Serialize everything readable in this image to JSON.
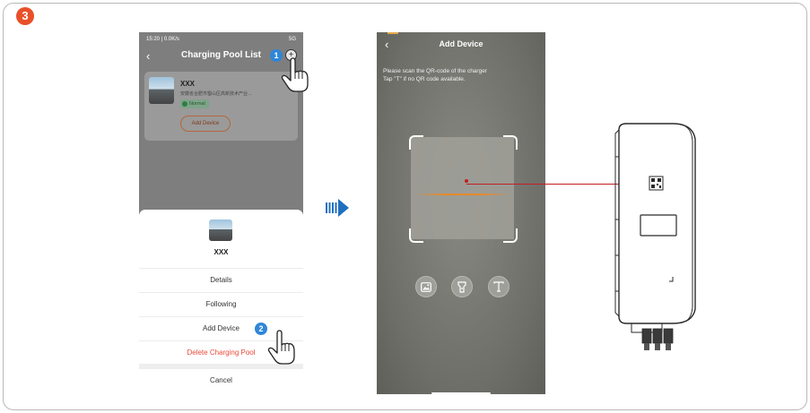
{
  "step_number": "3",
  "colors": {
    "accent": "#e8502a",
    "badge_blue": "#2f86d8",
    "danger": "#e84a3a",
    "scan_line": "#e68a2a",
    "pointer_line": "#c21f1f"
  },
  "phone1": {
    "status_bar": {
      "left": "15:20 | 0.0K/s",
      "right": "5G"
    },
    "title": "Charging Pool List",
    "back_icon": "chevron-left-icon",
    "add_icon": "plus-circle-icon",
    "card": {
      "name": "XXX",
      "address": "安徽省合肥市蜀山区高新技术产业...",
      "status": "Normal",
      "add_device_label": "Add Device"
    },
    "sheet": {
      "name": "XXX",
      "items": [
        {
          "label": "Details"
        },
        {
          "label": "Following"
        },
        {
          "label": "Add Device"
        },
        {
          "label": "Delete Charging Pool"
        }
      ],
      "cancel_label": "Cancel"
    },
    "callout_1": "1",
    "callout_2": "2"
  },
  "phone2": {
    "title": "Add Device",
    "back_icon": "chevron-left-icon",
    "tip_line1": "Please scan the QR-code of the charger",
    "tip_line2": "Tap \"T\" if no QR code available.",
    "tools": [
      "image-icon",
      "flashlight-icon",
      "text-input-icon"
    ]
  }
}
